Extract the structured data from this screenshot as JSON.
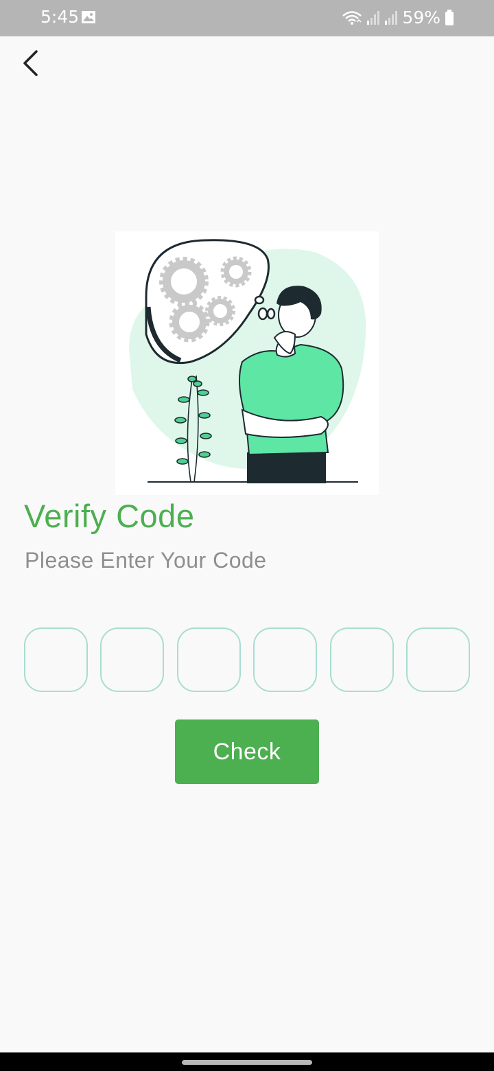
{
  "status_bar": {
    "time": "5:45",
    "battery": "59%",
    "icons": [
      "gallery-icon",
      "wifi-icon",
      "signal-icon",
      "signal-icon",
      "battery-icon"
    ]
  },
  "header": {
    "back_icon": "chevron-left-icon"
  },
  "illustration": {
    "description_icon": "thinking-person-illustration"
  },
  "main": {
    "title": "Verify Code",
    "subtitle": "Please Enter Your Code",
    "code_digits": [
      "",
      "",
      "",
      "",
      "",
      ""
    ],
    "check_label": "Check"
  },
  "colors": {
    "accent": "#4caf50",
    "input_border": "#a8ddd0",
    "status_bar": "#b5b5b5",
    "subtitle": "#8e8e8e"
  }
}
